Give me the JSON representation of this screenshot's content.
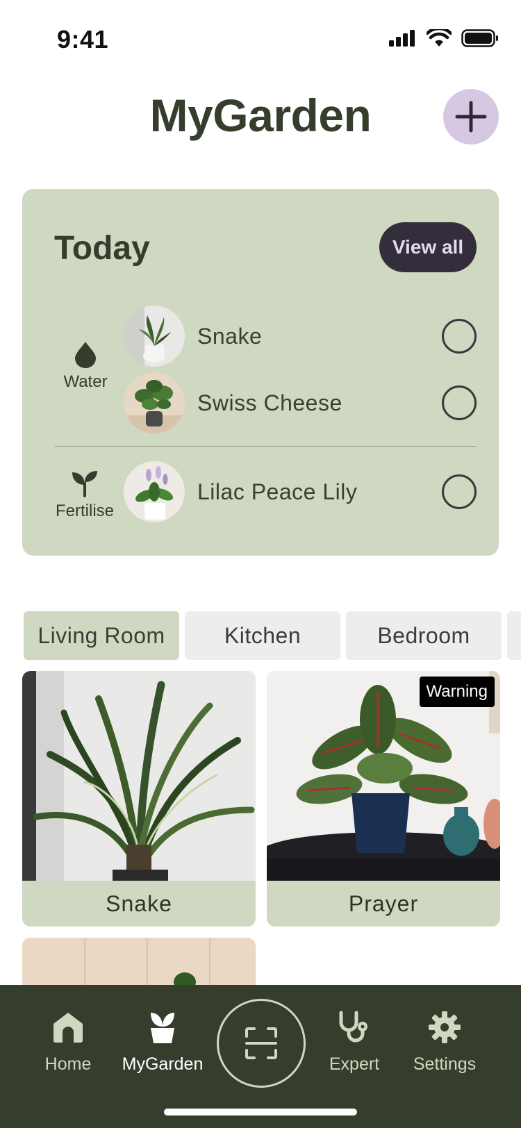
{
  "status_bar": {
    "time": "9:41"
  },
  "header": {
    "title": "MyGarden",
    "add_icon": "plus-icon"
  },
  "today": {
    "title": "Today",
    "view_all_label": "View all",
    "groups": [
      {
        "label": "Water",
        "icon": "water-drop-icon",
        "tasks": [
          {
            "name": "Snake"
          },
          {
            "name": "Swiss Cheese"
          }
        ]
      },
      {
        "label": "Fertilise",
        "icon": "sprout-icon",
        "tasks": [
          {
            "name": "Lilac Peace Lily"
          }
        ]
      }
    ]
  },
  "rooms": {
    "tabs": [
      {
        "label": "Living Room",
        "active": true
      },
      {
        "label": "Kitchen",
        "active": false
      },
      {
        "label": "Bedroom",
        "active": false
      }
    ]
  },
  "plants": [
    {
      "name": "Snake",
      "badge": ""
    },
    {
      "name": "Prayer",
      "badge": "Warning"
    }
  ],
  "nav": {
    "items": [
      {
        "label": "Home",
        "icon": "home-icon",
        "active": false
      },
      {
        "label": "MyGarden",
        "icon": "plant-icon",
        "active": true
      },
      {
        "label": "Expert",
        "icon": "stethoscope-icon",
        "active": false
      },
      {
        "label": "Settings",
        "icon": "gear-icon",
        "active": false
      }
    ],
    "scan_icon": "scan-icon"
  },
  "colors": {
    "primary_dark": "#353e2c",
    "card_green": "#cfd8c0",
    "accent_lilac": "#d6c8e2",
    "button_dark": "#342d3c"
  }
}
